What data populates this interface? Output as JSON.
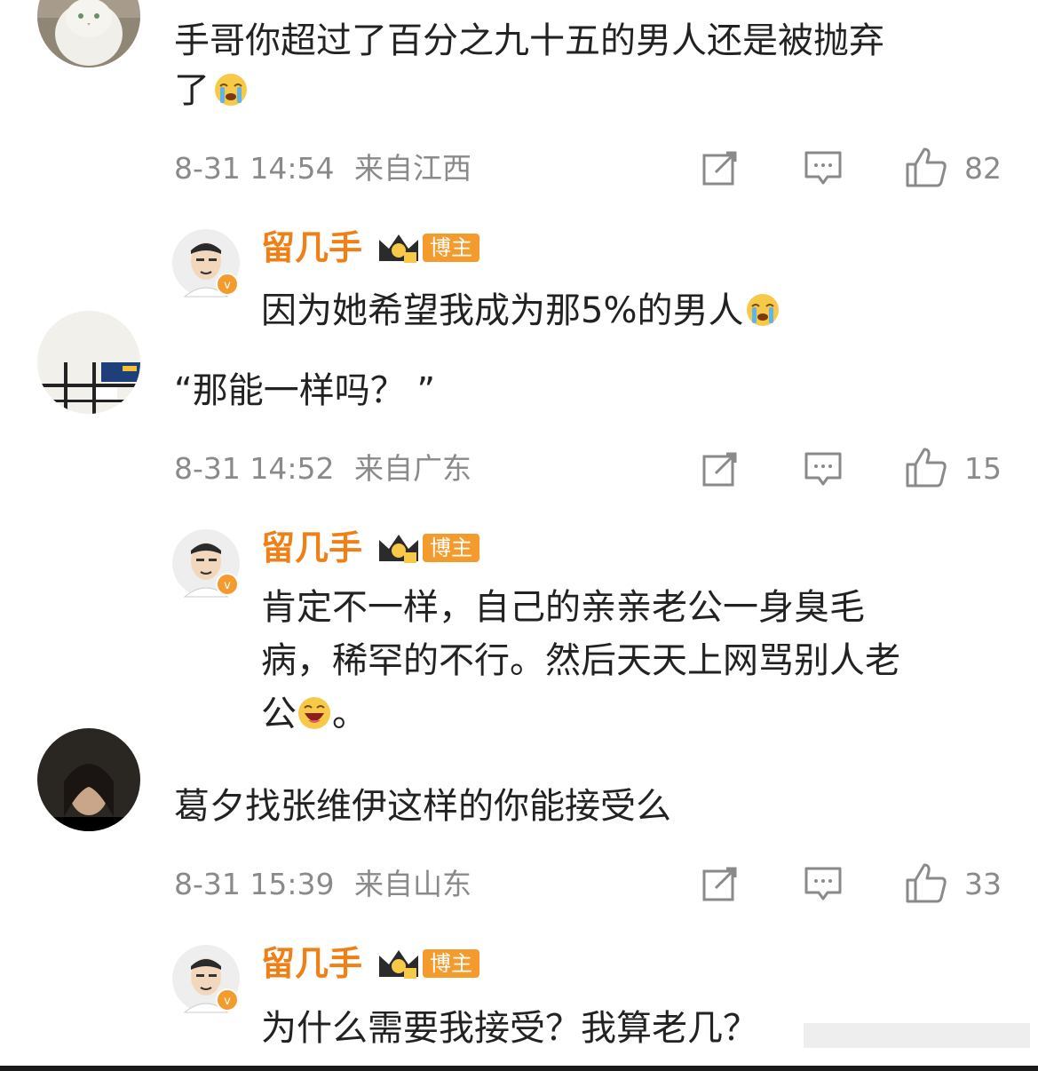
{
  "comments": [
    {
      "text_line1": "手哥你超过了百分之九十五的男人还是被抛弃",
      "text_line2": "了",
      "emoji": "crying-emoji",
      "time": "8-31 14:54",
      "location": "来自江西",
      "likes": "82",
      "reply": {
        "author": "留几手",
        "badge": "博主",
        "text": "因为她希望我成为那5%的男人",
        "emoji": "crying-emoji"
      }
    },
    {
      "text_line1": "“那能一样吗？ ”",
      "time": "8-31 14:52",
      "location": "来自广东",
      "likes": "15",
      "reply": {
        "author": "留几手",
        "badge": "博主",
        "line1": "肯定不一样，自己的亲亲老公一身臭毛",
        "line2": "病，稀罕的不行。然后天天上网骂别人老",
        "line3a": "公",
        "line3b": "。",
        "emoji": "laughing-emoji"
      }
    },
    {
      "text_line1": "葛夕找张维伊这样的你能接受么",
      "time": "8-31 15:39",
      "location": "来自山东",
      "likes": "33",
      "reply": {
        "author": "留几手",
        "badge": "博主",
        "text": "为什么需要我接受？我算老几？"
      }
    }
  ],
  "colors": {
    "author": "#f07f16",
    "badge": "#f39b2d",
    "meta": "#8a8a8a",
    "text": "#222222"
  }
}
